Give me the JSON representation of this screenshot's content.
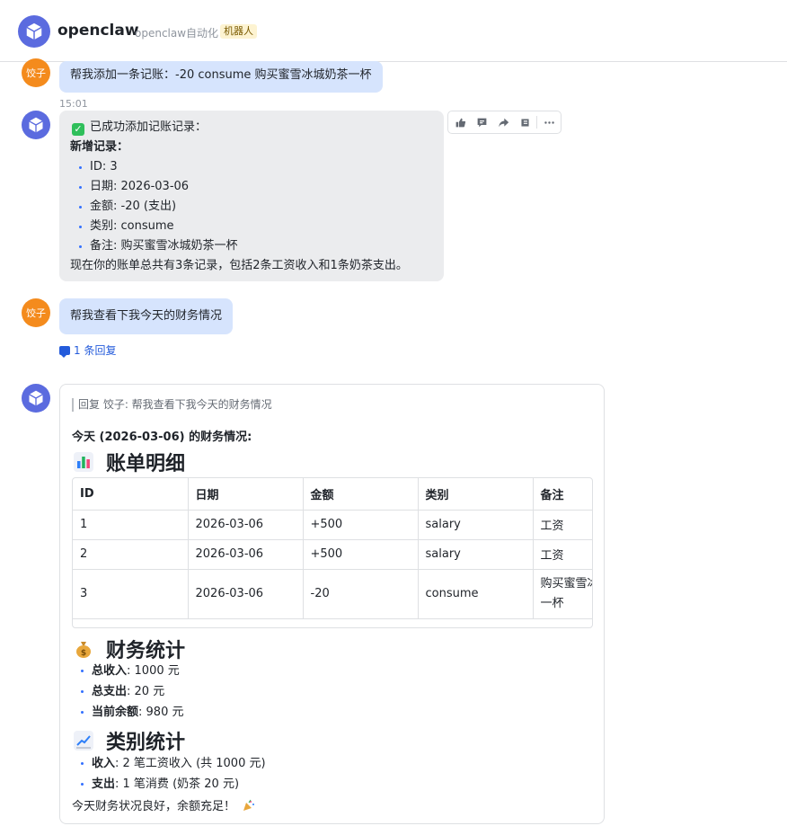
{
  "header": {
    "title": "openclaw",
    "subtitle": "openclaw自动化",
    "tag": "机器人"
  },
  "messages": {
    "m1": {
      "avatar_text": "饺子",
      "text": "帮我添加一条记账：-20 consume 购买蜜雪冰城奶茶一杯"
    },
    "timestamp": "15:01",
    "m2": {
      "status": "已成功添加记账记录：",
      "heading": "新增记录：",
      "items": [
        "ID: 3",
        "日期: 2026-03-06",
        "金额: -20 (支出)",
        "类别: consume",
        "备注: 购买蜜雪冰城奶茶一杯"
      ],
      "summary": "现在你的账单总共有3条记录，包括2条工资收入和1条奶茶支出。"
    },
    "m3": {
      "avatar_text": "饺子",
      "text": "帮我查看下我今天的财务情况"
    },
    "reply_link": "1 条回复"
  },
  "toolbar": {
    "icons": [
      "thumbs-up-icon",
      "comment-icon",
      "forward-icon",
      "bookmark-icon",
      "more-icon"
    ]
  },
  "card": {
    "quote": "回复 饺子: 帮我查看下我今天的财务情况",
    "intro": "今天 (2026-03-06) 的财务情况:",
    "section1_title": "账单明细",
    "table": {
      "headers": [
        "ID",
        "日期",
        "金额",
        "类别",
        "备注"
      ],
      "rows": [
        [
          "1",
          "2026-03-06",
          "+500",
          "salary",
          "工资"
        ],
        [
          "2",
          "2026-03-06",
          "+500",
          "salary",
          "工资"
        ],
        [
          "3",
          "2026-03-06",
          "-20",
          "consume",
          "购买蜜雪冰城奶茶一杯"
        ]
      ]
    },
    "section2_title": "财务统计",
    "stats": [
      {
        "label": "总收入",
        "value": ": 1000 元"
      },
      {
        "label": "总支出",
        "value": ": 20 元"
      },
      {
        "label": "当前余额",
        "value": ": 980 元"
      }
    ],
    "section3_title": "类别统计",
    "categories": [
      {
        "label": "收入",
        "value": ": 2 笔工资收入 (共 1000 元)"
      },
      {
        "label": "支出",
        "value": ": 1 笔消费 (奶茶 20 元)"
      }
    ],
    "footer": "今天财务状况良好，余额充足！"
  },
  "colors": {
    "bot_avatar": "#5b6bdf",
    "user_avatar": "#f48b1d",
    "user_bubble": "#d6e4fd",
    "bot_bubble": "#ebecee",
    "link": "#245bdb"
  }
}
